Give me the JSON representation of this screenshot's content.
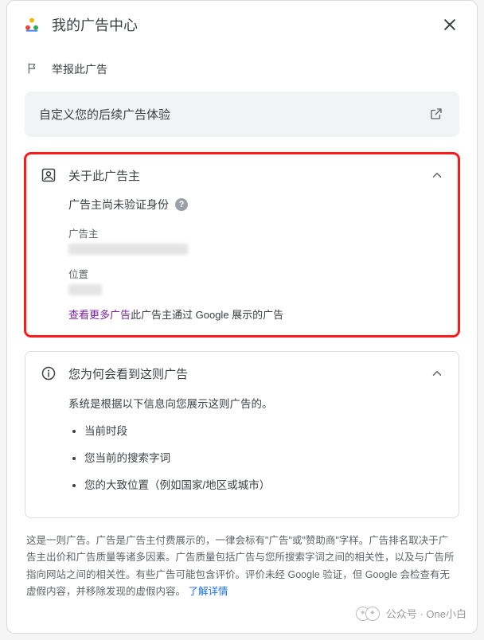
{
  "header": {
    "title": "我的广告中心"
  },
  "report": {
    "label": "举报此广告"
  },
  "customize": {
    "label": "自定义您的后续广告体验"
  },
  "about": {
    "title": "关于此广告主",
    "verify_text": "广告主尚未验证身份",
    "advertiser_label": "广告主",
    "location_label": "位置",
    "see_more_link": "查看更多广告",
    "see_more_suffix": "此广告主通过 Google 展示的广告"
  },
  "why": {
    "title": "您为何会看到这则广告",
    "intro": "系统是根据以下信息向您展示这则广告的。",
    "reasons": [
      "当前时段",
      "您当前的搜索字词",
      "您的大致位置（例如国家/地区或城市）"
    ]
  },
  "footer": {
    "text": "这是一则广告。广告是广告主付费展示的，一律会标有\"广告\"或\"赞助商\"字样。广告排名取决于广告主出价和广告质量等诸多因素。广告质量包括广告与您所搜索字词之间的相关性，以及与广告所指向网站之间的相关性。有些广告可能包含评价。评价未经 Google 验证，但 Google 会检查有无虚假内容，并移除发现的虚假内容。",
    "link": "了解详情"
  },
  "watermark": {
    "prefix": "公众号",
    "sep": " · ",
    "name": "One小白"
  }
}
